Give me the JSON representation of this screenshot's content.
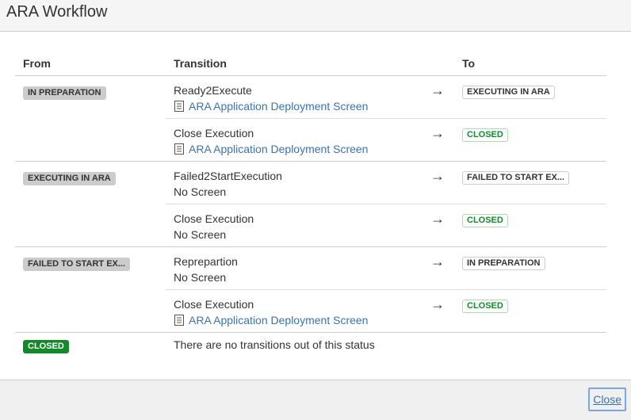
{
  "dialog": {
    "title": "ARA Workflow"
  },
  "table": {
    "headers": {
      "from": "From",
      "transition": "Transition",
      "to": "To"
    },
    "arrow": "→",
    "groups": [
      {
        "from": "IN PREPARATION",
        "transitions": [
          {
            "name": "Ready2Execute",
            "screen": "ARA Application Deployment Screen",
            "to": "EXECUTING IN ARA"
          },
          {
            "name": "Close Execution",
            "screen": "ARA Application Deployment Screen",
            "to": "CLOSED"
          }
        ]
      },
      {
        "from": "EXECUTING IN ARA",
        "transitions": [
          {
            "name": "Failed2StartExecution",
            "screen": "No Screen",
            "to": "FAILED TO START EX..."
          },
          {
            "name": "Close Execution",
            "screen": "No Screen",
            "to": "CLOSED"
          }
        ]
      },
      {
        "from": "FAILED TO START EX...",
        "transitions": [
          {
            "name": "Reprepartion",
            "screen": "No Screen",
            "to": "IN PREPARATION"
          },
          {
            "name": "Close Execution",
            "screen": "ARA Application Deployment Screen",
            "to": "CLOSED"
          }
        ]
      },
      {
        "from": "CLOSED",
        "no_transitions_text": "There are no transitions out of this status"
      }
    ]
  },
  "footer": {
    "close_label": "Close"
  },
  "colors": {
    "link": "#3b73af",
    "done_green": "#14892c",
    "default_grey": "#cccccc"
  },
  "icons": {
    "screen": "document-icon"
  }
}
